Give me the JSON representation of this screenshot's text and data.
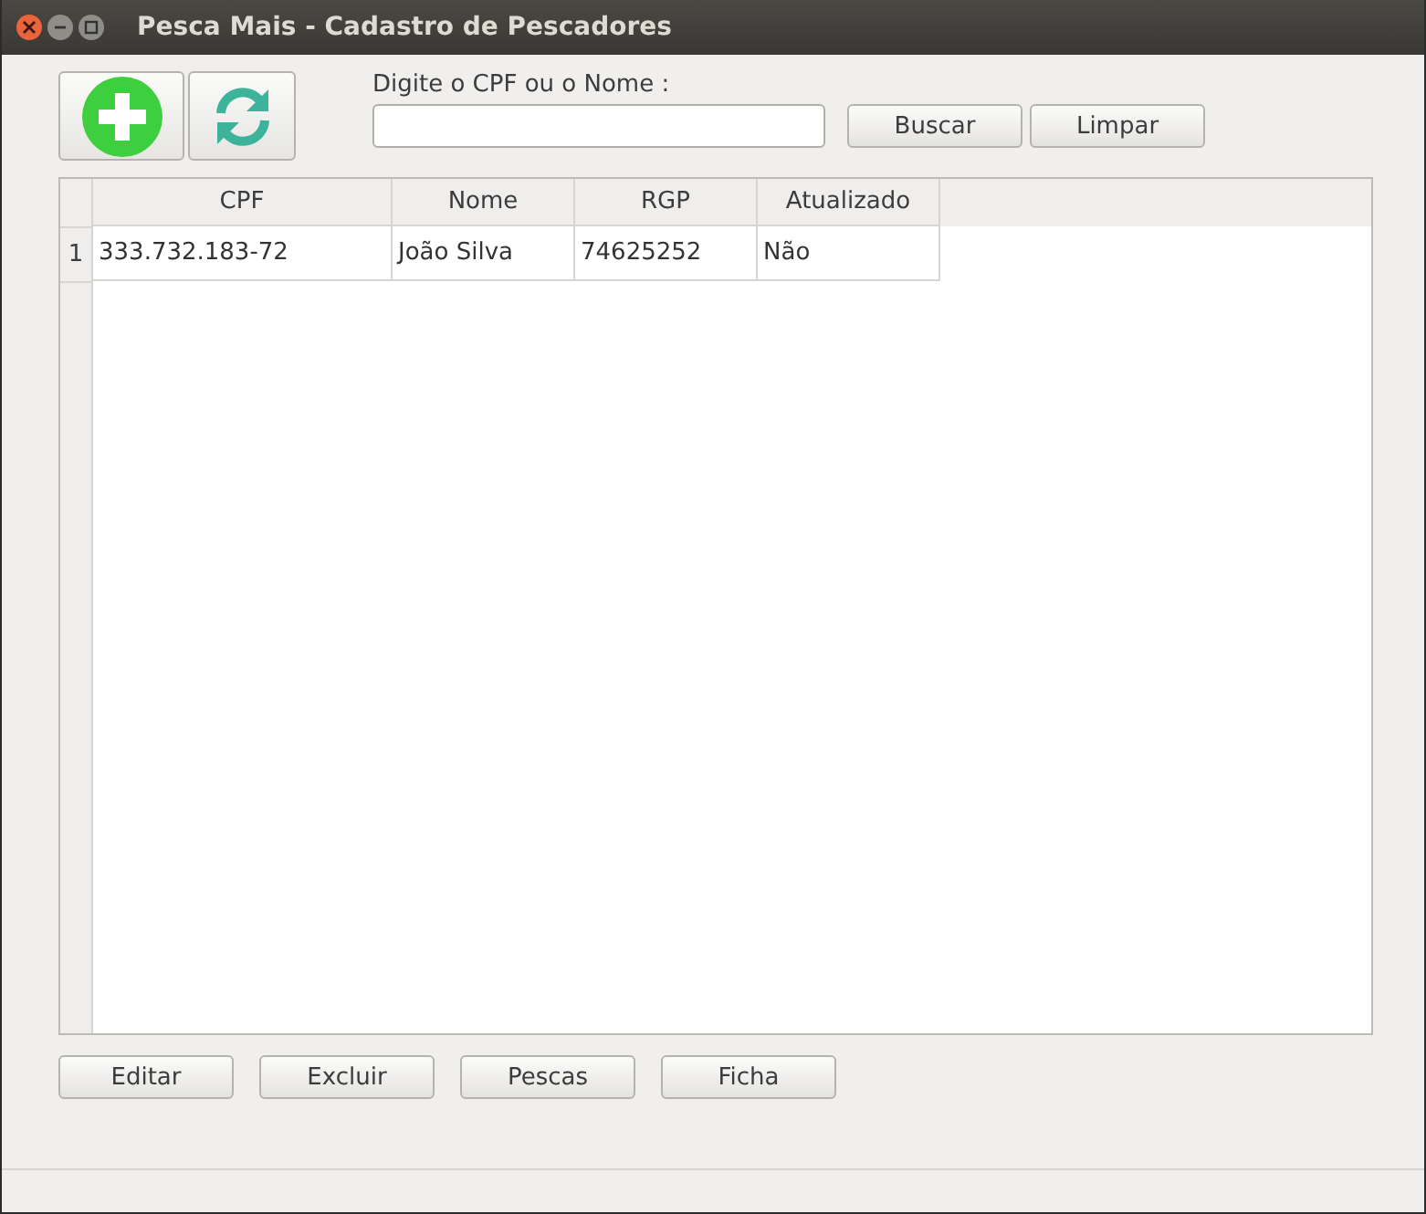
{
  "window": {
    "title": "Pesca Mais - Cadastro de Pescadores"
  },
  "search": {
    "label": "Digite o CPF ou o Nome :",
    "buttons": [
      "Buscar",
      "Limpar"
    ]
  },
  "table": {
    "columns": [
      "CPF",
      "Nome",
      "RGP",
      "Atualizado"
    ],
    "rows": [
      {
        "number": "1",
        "cells": [
          "333.732.183-72",
          "João Silva",
          "74625252",
          "Não"
        ]
      }
    ]
  },
  "buttons": [
    "Editar",
    "Excluir",
    "Pescas",
    "Ficha"
  ]
}
